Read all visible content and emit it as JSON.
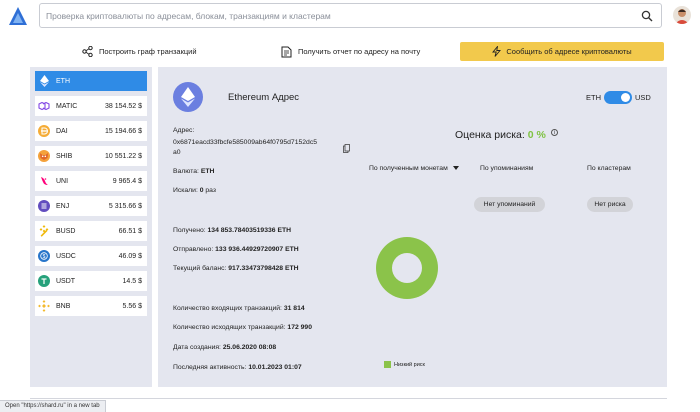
{
  "search": {
    "placeholder": "Проверка криптовалюты по адресам, блокам, транзакциям и кластерам"
  },
  "actions": {
    "graph_label": "Построить граф транзакций",
    "report_label": "Получить отчет по адресу на почту",
    "report_btn_label": "Сообщить об адресе криптовалюты"
  },
  "sidebar": {
    "items": [
      {
        "symbol": "ETH",
        "value": "",
        "icon": "eth-icon",
        "color": "#627eea"
      },
      {
        "symbol": "MATIC",
        "value": "38 154.52 $",
        "icon": "matic-icon",
        "color": "#8247e5"
      },
      {
        "symbol": "DAI",
        "value": "15 194.66 $",
        "icon": "dai-icon",
        "color": "#f5ac37"
      },
      {
        "symbol": "SHIB",
        "value": "10 551.22 $",
        "icon": "shib-icon",
        "color": "#e0662a"
      },
      {
        "symbol": "UNI",
        "value": "9 965.4 $",
        "icon": "uni-icon",
        "color": "#ff007a"
      },
      {
        "symbol": "ENJ",
        "value": "5 315.66 $",
        "icon": "enj-icon",
        "color": "#624dbf"
      },
      {
        "symbol": "BUSD",
        "value": "66.51 $",
        "icon": "busd-icon",
        "color": "#f0b90b"
      },
      {
        "symbol": "USDC",
        "value": "46.09 $",
        "icon": "usdc-icon",
        "color": "#2775ca"
      },
      {
        "symbol": "USDT",
        "value": "14.5 $",
        "icon": "usdt-icon",
        "color": "#26a17b"
      },
      {
        "symbol": "BNB",
        "value": "5.56 $",
        "icon": "bnb-icon",
        "color": "#f3ba2f"
      }
    ]
  },
  "main": {
    "title": "Ethereum Адрес",
    "toggle": {
      "left": "ETH",
      "right": "USD"
    },
    "address_label": "Адрес:",
    "address_line1": "0x6871eacd33fbcfe585009ab64f0795d7152dc5",
    "address_line2": "a0",
    "currency_label": "Валюта:",
    "currency_value": "ETH",
    "searched_label": "Искали:",
    "searched_value": "0",
    "searched_unit": "раз",
    "received_label": "Получено:",
    "received_value": "134 853.78403519336 ETH",
    "sent_label": "Отправлено:",
    "sent_value": "133 936.44929720907 ETH",
    "balance_label": "Текущий баланс:",
    "balance_value": "917.33473798428 ETH",
    "in_tx_label": "Количество входящих транзакций:",
    "in_tx_value": "31 814",
    "out_tx_label": "Количество исходящих транзакций:",
    "out_tx_value": "172 990",
    "created_label": "Дата создания:",
    "created_value": "25.06.2020 08:08",
    "last_label": "Последняя активность:",
    "last_value": "10.01.2023 01:07",
    "risk_label": "Оценка риска:",
    "risk_value": "0 %",
    "col_received": "По полученным монетам",
    "col_mentions": "По упоминаниям",
    "col_clusters": "По кластерам",
    "pill_mentions": "Нет упоминаний",
    "pill_risk": "Нет риска",
    "legend_low": "Низкий риск"
  },
  "colors": {
    "accent": "#2f8be6",
    "risk_low": "#8bc34a",
    "report_button": "#f2c94c"
  },
  "status_bar": "Open \"https://shard.ru\" in a new tab"
}
